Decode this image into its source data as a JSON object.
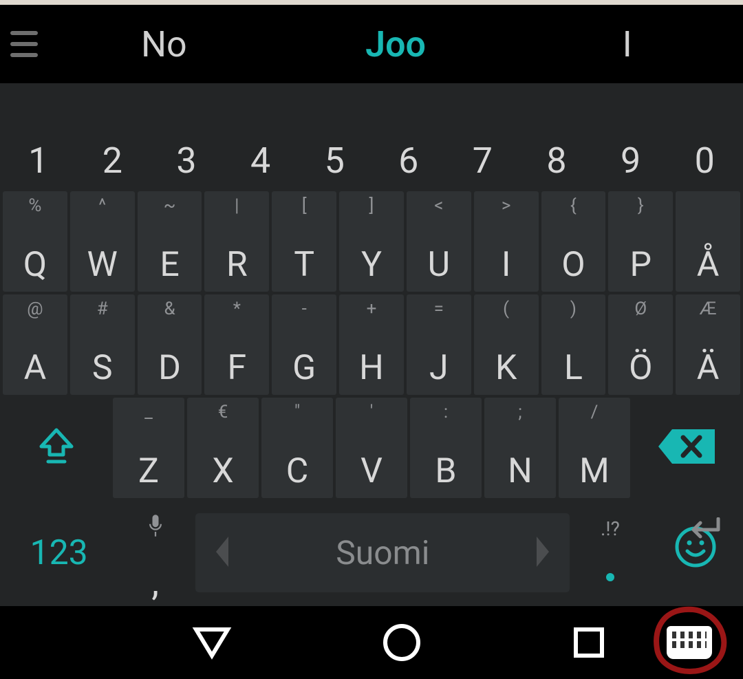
{
  "suggestions": {
    "left": "No",
    "center": "Joo",
    "right": "I"
  },
  "numbers": [
    "1",
    "2",
    "3",
    "4",
    "5",
    "6",
    "7",
    "8",
    "9",
    "0"
  ],
  "rowQ": [
    {
      "main": "Q",
      "hint": "%"
    },
    {
      "main": "W",
      "hint": "^"
    },
    {
      "main": "E",
      "hint": "~"
    },
    {
      "main": "R",
      "hint": "|"
    },
    {
      "main": "T",
      "hint": "["
    },
    {
      "main": "Y",
      "hint": "]"
    },
    {
      "main": "U",
      "hint": "<"
    },
    {
      "main": "I",
      "hint": ">"
    },
    {
      "main": "O",
      "hint": "{"
    },
    {
      "main": "P",
      "hint": "}"
    },
    {
      "main": "Å",
      "hint": ""
    }
  ],
  "rowA": [
    {
      "main": "A",
      "hint": "@"
    },
    {
      "main": "S",
      "hint": "#"
    },
    {
      "main": "D",
      "hint": "&"
    },
    {
      "main": "F",
      "hint": "*"
    },
    {
      "main": "G",
      "hint": "-"
    },
    {
      "main": "H",
      "hint": "+"
    },
    {
      "main": "J",
      "hint": "="
    },
    {
      "main": "K",
      "hint": "("
    },
    {
      "main": "L",
      "hint": ")"
    },
    {
      "main": "Ö",
      "hint": "Ø"
    },
    {
      "main": "Ä",
      "hint": "Æ"
    }
  ],
  "rowZ": [
    {
      "main": "Z",
      "hint": "_"
    },
    {
      "main": "X",
      "hint": "€"
    },
    {
      "main": "C",
      "hint": "\""
    },
    {
      "main": "V",
      "hint": "'"
    },
    {
      "main": "B",
      "hint": ":"
    },
    {
      "main": "N",
      "hint": ";"
    },
    {
      "main": "M",
      "hint": "/"
    }
  ],
  "bottom": {
    "symbols_label": "123",
    "comma": ",",
    "space_language": "Suomi",
    "period_hint": ".!?"
  },
  "colors": {
    "accent": "#18b7b3"
  },
  "annotation": {
    "circled": "keyboard-switch-icon"
  }
}
